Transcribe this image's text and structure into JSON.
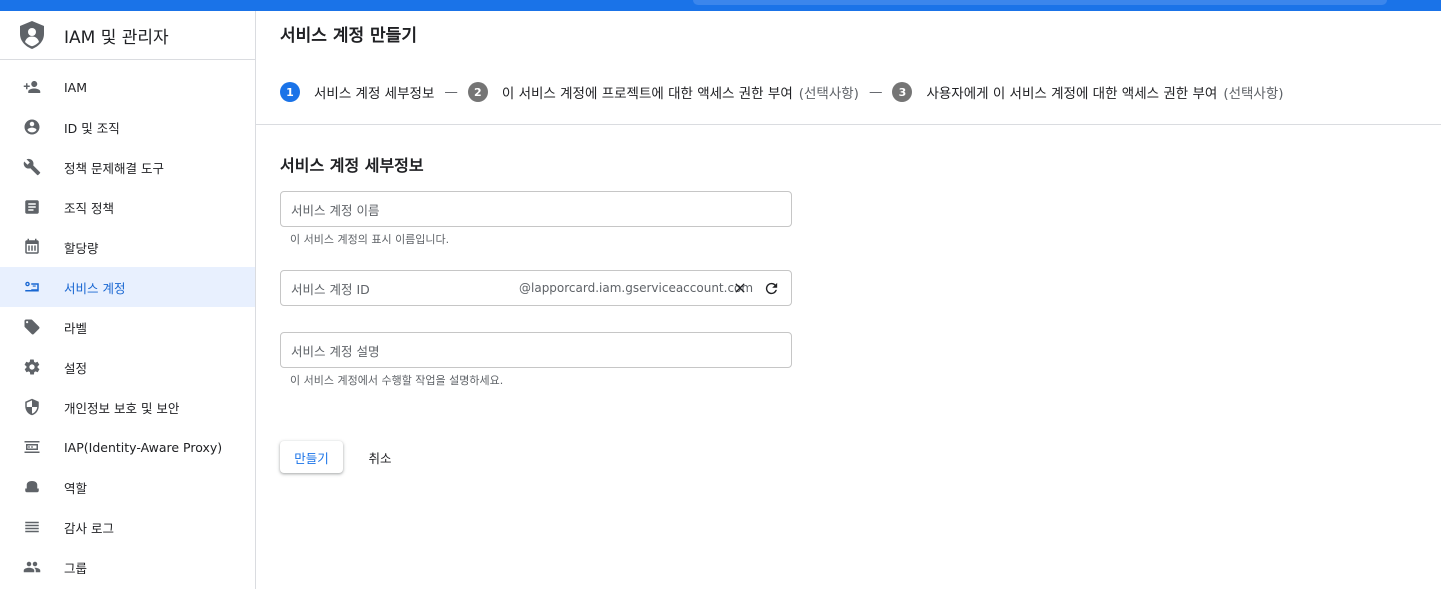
{
  "app": {
    "title": "IAM 및 관리자",
    "logo_icon": "shield-person-icon"
  },
  "sidebar": {
    "items": [
      {
        "label": "IAM",
        "icon": "person-add-icon",
        "active": false
      },
      {
        "label": "ID 및 조직",
        "icon": "account-circle-icon",
        "active": false
      },
      {
        "label": "정책 문제해결 도구",
        "icon": "wrench-icon",
        "active": false
      },
      {
        "label": "조직 정책",
        "icon": "article-icon",
        "active": false
      },
      {
        "label": "할당량",
        "icon": "calendar-icon",
        "active": false
      },
      {
        "label": "서비스 계정",
        "icon": "service-account-icon",
        "active": true
      },
      {
        "label": "라벨",
        "icon": "label-icon",
        "active": false
      },
      {
        "label": "설정",
        "icon": "gear-icon",
        "active": false
      },
      {
        "label": "개인정보 보호 및 보안",
        "icon": "security-shield-icon",
        "active": false
      },
      {
        "label": "IAP(Identity-Aware Proxy)",
        "icon": "iap-icon",
        "active": false
      },
      {
        "label": "역할",
        "icon": "role-hat-icon",
        "active": false
      },
      {
        "label": "감사 로그",
        "icon": "list-lines-icon",
        "active": false
      },
      {
        "label": "그룹",
        "icon": "group-icon",
        "active": false
      }
    ]
  },
  "main": {
    "page_title": "서비스 계정 만들기",
    "steps": [
      {
        "number": "1",
        "label": "서비스 계정 세부정보",
        "optional": ""
      },
      {
        "number": "2",
        "label": "이 서비스 계정에 프로젝트에 대한 액세스 권한 부여",
        "optional": "(선택사항)"
      },
      {
        "number": "3",
        "label": "사용자에게 이 서비스 계정에 대한 액세스 권한 부여",
        "optional": "(선택사항)"
      }
    ],
    "step_separator": "—",
    "section_title": "서비스 계정 세부정보",
    "name_field": {
      "placeholder": "서비스 계정 이름",
      "value": "",
      "hint": "이 서비스 계정의 표시 이름입니다."
    },
    "id_field": {
      "placeholder": "서비스 계정 ID",
      "value": "",
      "suffix": "@lapporcard.iam.gserviceaccount.com",
      "clear_icon": "close-icon",
      "refresh_icon": "refresh-icon"
    },
    "desc_field": {
      "placeholder": "서비스 계정 설명",
      "value": "",
      "hint": "이 서비스 계정에서 수행할 작업을 설명하세요."
    },
    "buttons": {
      "create": "만들기",
      "cancel": "취소"
    }
  },
  "colors": {
    "accent": "#1a73e8",
    "active_bg": "#e8f0fe",
    "active_text": "#1967d2",
    "step_inactive": "#757575"
  }
}
